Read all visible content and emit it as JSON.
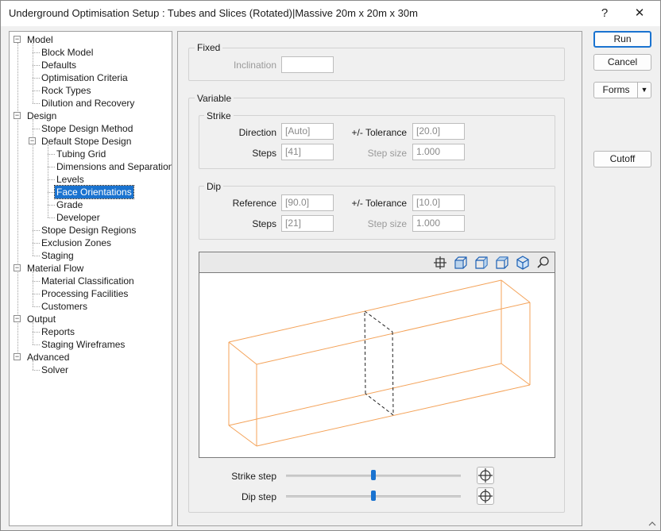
{
  "window": {
    "title": "Underground Optimisation Setup : Tubes and Slices (Rotated)|Massive 20m x 20m x 30m",
    "help_glyph": "?",
    "close_glyph": "✕"
  },
  "tree": {
    "items": [
      {
        "label": "Model",
        "expander": "−"
      },
      {
        "label": "Block Model"
      },
      {
        "label": "Defaults"
      },
      {
        "label": "Optimisation Criteria"
      },
      {
        "label": "Rock Types"
      },
      {
        "label": "Dilution and Recovery"
      },
      {
        "label": "Design",
        "expander": "−"
      },
      {
        "label": "Stope Design Method"
      },
      {
        "label": "Default Stope Design",
        "expander": "−"
      },
      {
        "label": "Tubing Grid"
      },
      {
        "label": "Dimensions and Separations"
      },
      {
        "label": "Levels"
      },
      {
        "label": "Face Orientations",
        "selected": true
      },
      {
        "label": "Grade"
      },
      {
        "label": "Developer"
      },
      {
        "label": "Stope Design Regions"
      },
      {
        "label": "Exclusion Zones"
      },
      {
        "label": "Staging"
      },
      {
        "label": "Material Flow",
        "expander": "−"
      },
      {
        "label": "Material Classification"
      },
      {
        "label": "Processing Facilities"
      },
      {
        "label": "Customers"
      },
      {
        "label": "Output",
        "expander": "−"
      },
      {
        "label": "Reports"
      },
      {
        "label": "Staging Wireframes"
      },
      {
        "label": "Advanced",
        "expander": "−"
      },
      {
        "label": "Solver"
      }
    ]
  },
  "fixed": {
    "label": "Fixed",
    "inclination_label": "Inclination",
    "inclination_value": ""
  },
  "variable": {
    "label": "Variable",
    "strike": {
      "label": "Strike",
      "direction_label": "Direction",
      "direction_value": "[Auto]",
      "tolerance_label": "+/- Tolerance",
      "tolerance_value": "[20.0]",
      "steps_label": "Steps",
      "steps_value": "[41]",
      "step_size_label": "Step size",
      "step_size_value": "1.000"
    },
    "dip": {
      "label": "Dip",
      "reference_label": "Reference",
      "reference_value": "[90.0]",
      "tolerance_label": "+/- Tolerance",
      "tolerance_value": "[10.0]",
      "steps_label": "Steps",
      "steps_value": "[21]",
      "step_size_label": "Step size",
      "step_size_value": "1.000"
    },
    "sliders": {
      "strike_label": "Strike step",
      "strike_position": 0.5,
      "dip_label": "Dip step",
      "dip_position": 0.5
    }
  },
  "viewer": {
    "toolbar_icons": [
      "fit-view-icon",
      "front-view-icon",
      "side-view-icon",
      "top-view-icon",
      "iso-view-icon",
      "zoom-icon"
    ],
    "box_color": "#f4a35a",
    "slice_color": "#222222"
  },
  "actions": {
    "run": "Run",
    "cancel": "Cancel",
    "forms": "Forms",
    "cutoff": "Cutoff"
  },
  "colors": {
    "accent": "#1a73d0",
    "window_bg": "#f0f0f0"
  }
}
